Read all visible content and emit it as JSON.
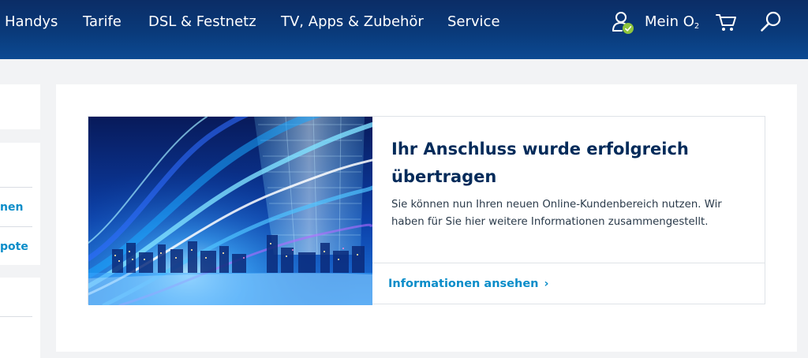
{
  "nav": {
    "items": [
      {
        "label": "Handys"
      },
      {
        "label": "Tarife"
      },
      {
        "label": "DSL & Festnetz"
      },
      {
        "label": "TV, Apps & Zubehör"
      },
      {
        "label": "Service"
      }
    ],
    "account_label": "Mein O",
    "account_label_sub": "2",
    "account_status_color": "#8fc53c",
    "icons": [
      "user-icon",
      "cart-icon",
      "search-icon"
    ]
  },
  "sidebar": {
    "links": [
      {
        "label": "nen"
      },
      {
        "label": "pote"
      }
    ]
  },
  "teaser": {
    "title": "Ihr Anschluss wurde erfolgreich übertragen",
    "text": "Sie können nun Ihren neuen Online-Kundenbereich nutzen. Wir haben für Sie hier weitere Informationen zusammengestellt.",
    "link_label": "Informationen ansehen",
    "link_chevron": "›"
  },
  "colors": {
    "header": "#0a3a7a",
    "link": "#0a8dc9",
    "title": "#032b5a",
    "background": "#f2f3f5"
  }
}
